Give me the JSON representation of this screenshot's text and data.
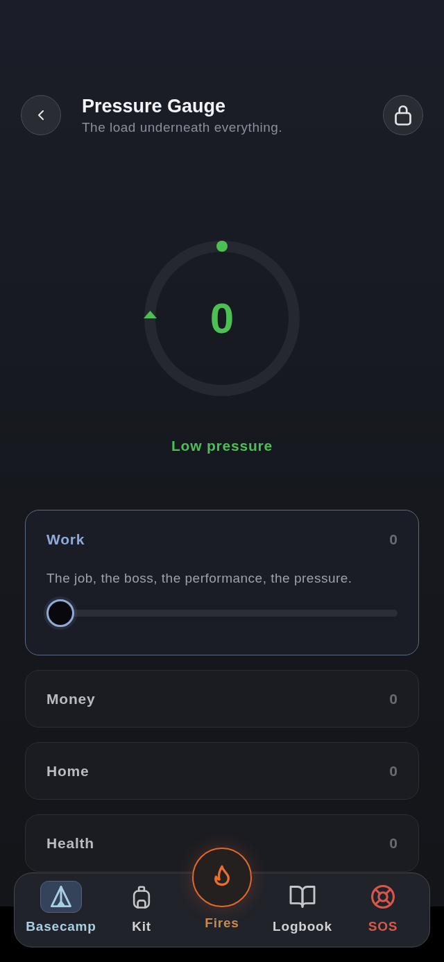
{
  "header": {
    "title": "Pressure Gauge",
    "subtitle": "The load underneath everything."
  },
  "gauge": {
    "value": "0",
    "status": "Low pressure"
  },
  "categories": [
    {
      "name": "Work",
      "value": "0",
      "expanded": true,
      "description": "The job, the boss, the performance, the pressure.",
      "level": 0
    },
    {
      "name": "Money",
      "value": "0",
      "expanded": false
    },
    {
      "name": "Home",
      "value": "0",
      "expanded": false
    },
    {
      "name": "Health",
      "value": "0",
      "expanded": false
    }
  ],
  "nav": [
    {
      "label": "Basecamp",
      "kind": "tab",
      "selected": true
    },
    {
      "label": "Kit",
      "kind": "tab",
      "selected": false
    },
    {
      "label": "Fires",
      "kind": "action",
      "selected": false
    },
    {
      "label": "Logbook",
      "kind": "tab",
      "selected": false
    },
    {
      "label": "SOS",
      "kind": "alert",
      "selected": false
    }
  ]
}
